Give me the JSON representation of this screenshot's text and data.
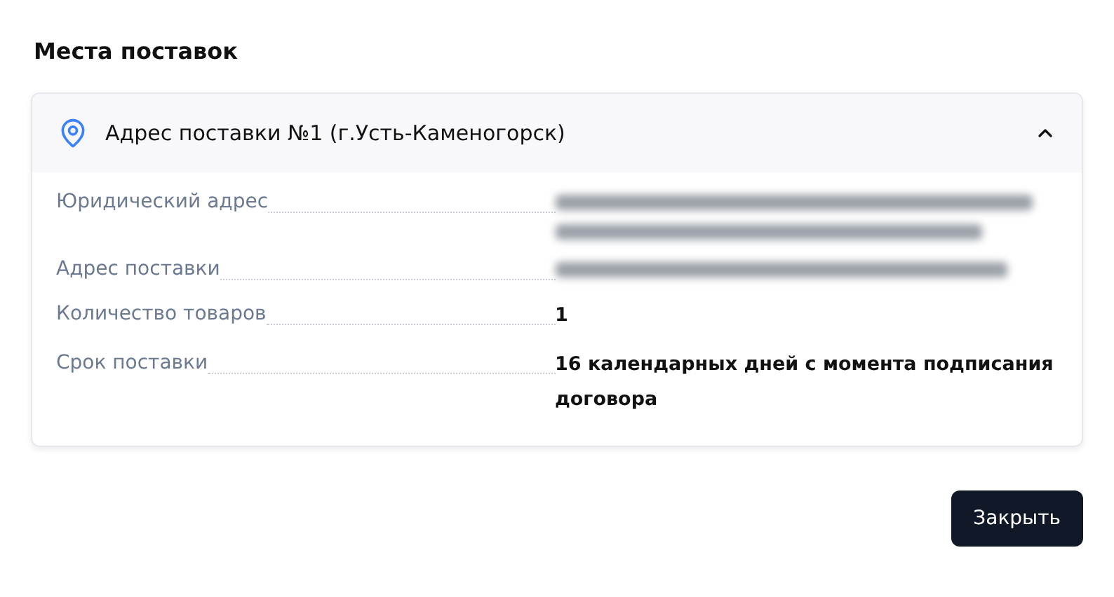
{
  "title": "Места поставок",
  "accordion": {
    "title": "Адрес поставки №1 (г.Усть-Каменогорск)",
    "expanded": true,
    "rows": [
      {
        "label": "Юридический адрес",
        "kind": "redacted",
        "multiline": true
      },
      {
        "label": "Адрес поставки",
        "kind": "redacted",
        "multiline": false
      },
      {
        "label": "Количество товаров",
        "kind": "text",
        "value": "1"
      },
      {
        "label": "Срок поставки",
        "kind": "text",
        "value": "16 календарных дней с момента подписания договора"
      }
    ]
  },
  "close_button": "Закрыть"
}
